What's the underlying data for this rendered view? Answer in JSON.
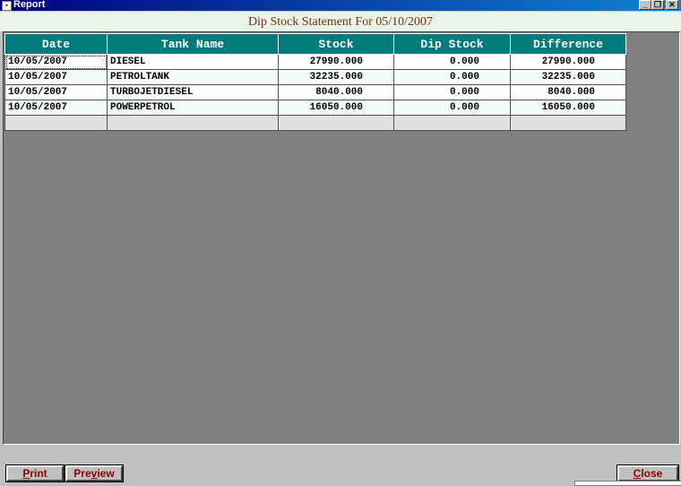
{
  "window": {
    "title": "Report",
    "app_icon": "report-window-icon"
  },
  "heading": "Dip Stock Statement For 05/10/2007",
  "table": {
    "columns": [
      "Date",
      "Tank Name",
      "Stock",
      "Dip Stock",
      "Difference"
    ],
    "rows": [
      [
        "10/05/2007",
        "DIESEL",
        "27990.000",
        "0.000",
        "27990.000"
      ],
      [
        "10/05/2007",
        "PETROLTANK",
        "32235.000",
        "0.000",
        "32235.000"
      ],
      [
        "10/05/2007",
        "TURBOJETDIESEL",
        "8040.000",
        "0.000",
        "8040.000"
      ],
      [
        "10/05/2007",
        "POWERPETROL",
        "16050.000",
        "0.000",
        "16050.000"
      ]
    ]
  },
  "buttons": {
    "print": {
      "mnemonic": "P",
      "rest": "rint"
    },
    "preview": {
      "before": "Pre",
      "mnemonic": "v",
      "rest": "iew"
    },
    "close": {
      "mnemonic": "C",
      "rest": "lose"
    }
  },
  "colors": {
    "header_bg": "#007b7b",
    "title_text": "#7a2c10",
    "button_text": "#8b0000"
  }
}
